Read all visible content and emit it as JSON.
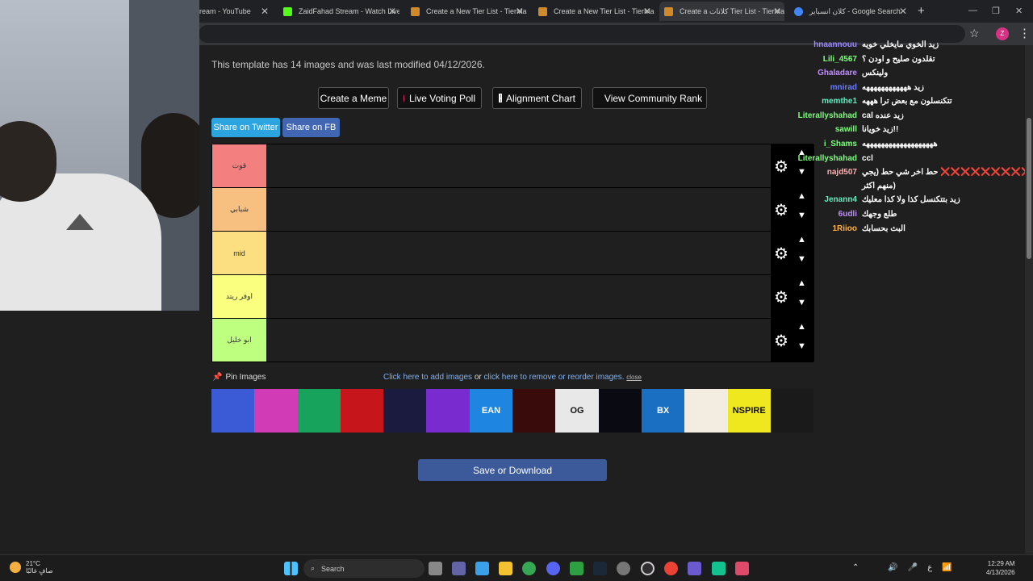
{
  "browser": {
    "tabs": [
      {
        "title": "ream - YouTube",
        "color": "#ff0000"
      },
      {
        "title": "ZaidFahad Stream - Watch Live",
        "color": "#53fc18"
      },
      {
        "title": "Create a New Tier List - TierMaker",
        "color": "#d08a2c"
      },
      {
        "title": "Create a New Tier List - TierMaker",
        "color": "#d08a2c"
      },
      {
        "title": "Create a كلانات Tier List - TierMaker",
        "color": "#d08a2c"
      },
      {
        "title": "كلان انسباير - Google Search",
        "color": "#4285f4"
      }
    ],
    "new_tab": "+",
    "profile_initial": "Z"
  },
  "page": {
    "info_text": "This template has 14 images and was last modified 04/12/2026.",
    "buttons": {
      "create_meme": "Create a Meme",
      "live_voting": "Live Voting Poll",
      "alignment_chart": "Alignment Chart",
      "community_rank": "View Community Rank",
      "share_twitter": "Share on Twitter",
      "share_fb": "Share on FB"
    },
    "tiers": [
      {
        "label": "قوت",
        "color": "#f47f7f"
      },
      {
        "label": "شبابي",
        "color": "#f7bf80"
      },
      {
        "label": "mid",
        "color": "#fcdf80"
      },
      {
        "label": "اوفر ريتد",
        "color": "#fbff7f"
      },
      {
        "label": "ابو خليل",
        "color": "#bfff7f"
      }
    ],
    "pin_images": "Pin Images",
    "links": {
      "add_images": "Click here to add images",
      "or": "or",
      "remove_reorder": "click here to remove or reorder images.",
      "close": "close"
    },
    "images": [
      {
        "name": "img-1",
        "bg": "#3b5bd6",
        "text": ""
      },
      {
        "name": "img-2",
        "bg": "#d13bb5",
        "text": ""
      },
      {
        "name": "img-3",
        "bg": "#18a35d",
        "text": ""
      },
      {
        "name": "img-4",
        "bg": "#c6161c",
        "text": ""
      },
      {
        "name": "img-5",
        "bg": "#1b1b40",
        "text": ""
      },
      {
        "name": "img-6",
        "bg": "#7a2bd0",
        "text": ""
      },
      {
        "name": "img-7",
        "bg": "#1e86e0",
        "text": "EAN"
      },
      {
        "name": "img-8",
        "bg": "#3a0b0b",
        "text": ""
      },
      {
        "name": "img-9",
        "bg": "#e8e8e8",
        "text": "OG"
      },
      {
        "name": "img-10",
        "bg": "#0a0a12",
        "text": ""
      },
      {
        "name": "img-11",
        "bg": "#1b6fc2",
        "text": "BX"
      },
      {
        "name": "img-12",
        "bg": "#f3ece0",
        "text": ""
      },
      {
        "name": "img-13",
        "bg": "#f0e81e",
        "text": "NSPIRE"
      },
      {
        "name": "img-14",
        "bg": "#1a1a1a",
        "text": ""
      }
    ],
    "save_button": "Save or Download"
  },
  "chat": [
    {
      "user": "hnaannouu",
      "color": "#9b8cff",
      "msg": "زيد الخوي مايخلي خويه"
    },
    {
      "user": "Lili_4567",
      "color": "#7cff7c",
      "msg": "تقلدون صليح و اودن ؟"
    },
    {
      "user": "Ghaladare",
      "color": "#c08cff",
      "msg": "ولينكس"
    },
    {
      "user": "mnirad",
      "color": "#6a7cff",
      "msg": "زيد ههههههههههههه"
    },
    {
      "user": "memthe1",
      "color": "#5cf0c0",
      "msg": "تتكنسلون مع بعض ترا هههه"
    },
    {
      "user": "Literallyshahad",
      "color": "#7cff7c",
      "msg": "cal زيد عنده"
    },
    {
      "user": "sawill",
      "color": "#7cff7c",
      "msg": "زيد خويانا!!"
    },
    {
      "user": "i_Shams",
      "color": "#7cff7c",
      "msg": "هههههههههههههههههههه"
    },
    {
      "user": "Literallyshahad",
      "color": "#7cff7c",
      "msg": "ccl"
    },
    {
      "user": "najd507",
      "color": "#ffb0b0",
      "msg": "حط اخر شي حط (يجي ❌❌❌❌❌❌❌❌❌"
    },
    {
      "user": "",
      "color": "#ffffff",
      "msg": "منهم اكثر)"
    },
    {
      "user": "Jenann4",
      "color": "#5cf0c0",
      "msg": "زيد بتتكنسل كذا ولا كذا معليك"
    },
    {
      "user": "6udli",
      "color": "#c08cff",
      "msg": "طلع وجهك"
    },
    {
      "user": "1Riioo",
      "color": "#ffb347",
      "msg": "البث بحسابك"
    }
  ],
  "taskbar": {
    "weather_temp": "21°C",
    "weather_desc": "صافٍ غالبًا",
    "search_label": "Search",
    "lang": "ع",
    "time": "12:29 AM",
    "date": "4/13/2026"
  }
}
